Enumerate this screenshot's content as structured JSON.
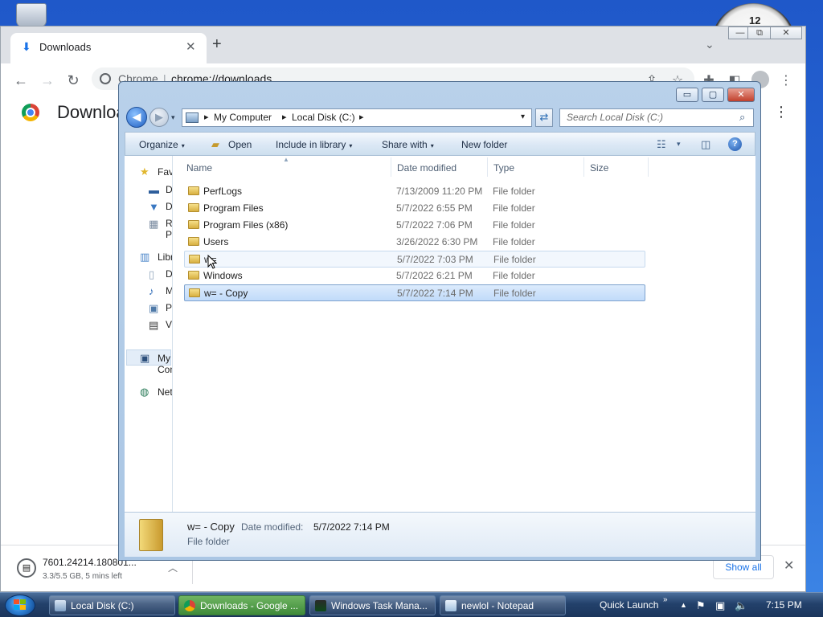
{
  "chrome": {
    "tab_title": "Downloads",
    "tab_close": "✕",
    "new_tab": "+",
    "tab_search": "⌄",
    "win_minimize": "—",
    "win_restore": "⧉",
    "win_close": "✕",
    "back": "←",
    "forward": "→",
    "reload": "↻",
    "omni_site": "Chrome",
    "omni_sep": "|",
    "omni_url": "chrome://downloads",
    "share": "⇪",
    "star": "☆",
    "extensions": "✚",
    "side_panel": "◧",
    "menu": "⋮",
    "page_title": "Downloads",
    "page_more": "⋮"
  },
  "shelf": {
    "file_name": "7601.24214.180801...",
    "meta": "3.3/5.5 GB, 5 mins left",
    "chevron": "︿",
    "show_all": "Show all",
    "close": "✕"
  },
  "explorer": {
    "minimize": "▭",
    "maximize": "▢",
    "close": "✕",
    "back": "◀",
    "forward": "▶",
    "recent": "▾",
    "breadcrumbs": [
      "My Computer",
      "Local Disk (C:)"
    ],
    "crumb_sep": "▸",
    "addr_drop": "▾",
    "refresh": "⇄",
    "search_placeholder": "Search Local Disk (C:)",
    "search_icon": "⌕",
    "commands": [
      {
        "label": "Organize",
        "arrow": "▾"
      },
      {
        "label": "Open",
        "arrow": ""
      },
      {
        "label": "Include in library",
        "arrow": "▾"
      },
      {
        "label": "Share with",
        "arrow": "▾"
      },
      {
        "label": "New folder",
        "arrow": ""
      }
    ],
    "views_icon": "☷",
    "views_arrow": "▾",
    "preview_icon": "◫",
    "help": "?",
    "nav": {
      "favorites": "Favorites",
      "desktop": "Desktop",
      "downloads": "Downloads",
      "recent": "Recent Places",
      "libraries": "Libraries",
      "documents": "Documents",
      "music": "Music",
      "pictures": "Pictures",
      "videos": "Videos",
      "computer": "My Computer",
      "network": "Network"
    },
    "columns": [
      "Name",
      "Date modified",
      "Type",
      "Size"
    ],
    "sort_arrow": "▲",
    "rows": [
      {
        "name": "PerfLogs",
        "date": "7/13/2009 11:20 PM",
        "type": "File folder"
      },
      {
        "name": "Program Files",
        "date": "5/7/2022 6:55 PM",
        "type": "File folder"
      },
      {
        "name": "Program Files (x86)",
        "date": "5/7/2022 7:06 PM",
        "type": "File folder"
      },
      {
        "name": "Users",
        "date": "3/26/2022 6:30 PM",
        "type": "File folder"
      },
      {
        "name": "w=",
        "date": "5/7/2022 7:03 PM",
        "type": "File folder"
      },
      {
        "name": "Windows",
        "date": "5/7/2022 6:21 PM",
        "type": "File folder"
      },
      {
        "name": "w= - Copy",
        "date": "5/7/2022 7:14 PM",
        "type": "File folder"
      }
    ],
    "details": {
      "name": "w= - Copy",
      "date_label": "Date modified:",
      "date_value": "5/7/2022 7:14 PM",
      "type": "File folder"
    }
  },
  "taskbar": {
    "items": [
      {
        "label": "Local Disk (C:)"
      },
      {
        "label": "Downloads - Google ..."
      },
      {
        "label": "Windows Task Mana..."
      },
      {
        "label": "newlol - Notepad"
      }
    ],
    "quick_launch": "Quick Launch",
    "quick_launch_chevron": "»",
    "tray_up": "▲",
    "tray_flag": "⚑",
    "tray_network": "▣",
    "tray_volume": "🔈",
    "time": "7:15 PM"
  },
  "clock_number": "12"
}
